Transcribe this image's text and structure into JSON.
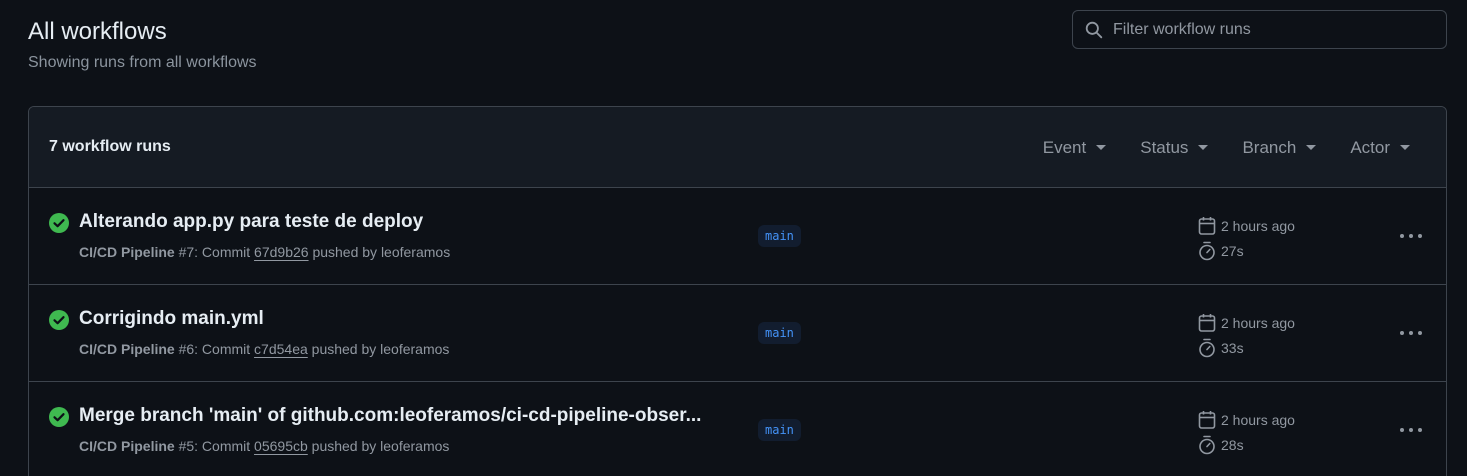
{
  "header": {
    "title": "All workflows",
    "subtitle": "Showing runs from all workflows"
  },
  "search": {
    "placeholder": "Filter workflow runs",
    "value": ""
  },
  "runs_box": {
    "count_label": "7 workflow runs",
    "filters": [
      {
        "label": "Event"
      },
      {
        "label": "Status"
      },
      {
        "label": "Branch"
      },
      {
        "label": "Actor"
      }
    ]
  },
  "runs": [
    {
      "title": "Alterando app.py para teste de deploy",
      "workflow": "CI/CD Pipeline",
      "run_number": "#7",
      "commit_prefix": ": Commit ",
      "sha": "67d9b26",
      "pushed_by": " pushed by leoferamos",
      "branch": "main",
      "when": "2 hours ago",
      "duration": "27s",
      "status": "success"
    },
    {
      "title": "Corrigindo main.yml",
      "workflow": "CI/CD Pipeline",
      "run_number": "#6",
      "commit_prefix": ": Commit ",
      "sha": "c7d54ea",
      "pushed_by": " pushed by leoferamos",
      "branch": "main",
      "when": "2 hours ago",
      "duration": "33s",
      "status": "success"
    },
    {
      "title": "Merge branch 'main' of github.com:leoferamos/ci-cd-pipeline-obser...",
      "workflow": "CI/CD Pipeline",
      "run_number": "#5",
      "commit_prefix": ": Commit ",
      "sha": "05695cb",
      "pushed_by": " pushed by leoferamos",
      "branch": "main",
      "when": "2 hours ago",
      "duration": "28s",
      "status": "success"
    }
  ],
  "colors": {
    "background": "#0d1117",
    "success": "#3fb950",
    "branch_text": "#4493f8",
    "muted": "#9198a1"
  },
  "icons": {
    "search": "search-icon",
    "status": "check-circle-icon",
    "calendar": "calendar-icon",
    "stopwatch": "stopwatch-icon",
    "more": "kebab-icon"
  }
}
